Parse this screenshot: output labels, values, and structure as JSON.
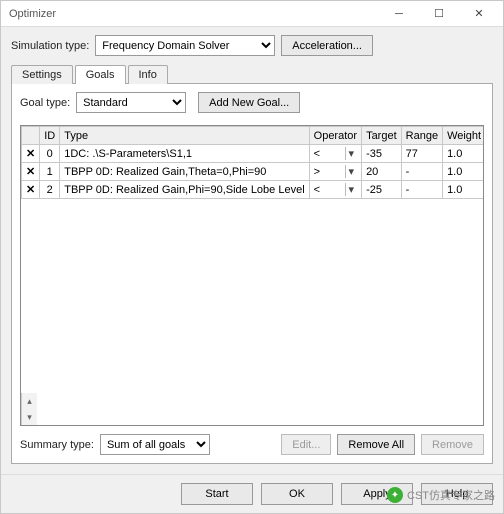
{
  "window": {
    "title": "Optimizer"
  },
  "simType": {
    "label": "Simulation type:",
    "value": "Frequency Domain Solver"
  },
  "accelBtn": "Acceleration...",
  "tabs": {
    "settings": "Settings",
    "goals": "Goals",
    "info": "Info",
    "active": "goals"
  },
  "goalType": {
    "label": "Goal type:",
    "value": "Standard"
  },
  "addGoalBtn": "Add New Goal...",
  "columns": {
    "id": "ID",
    "type": "Type",
    "operator": "Operator",
    "target": "Target",
    "range": "Range",
    "weight": "Weight"
  },
  "rows": [
    {
      "checked": true,
      "id": "0",
      "type": "1DC: .\\S-Parameters\\S1,1",
      "op": "<",
      "target": "-35",
      "range": "77",
      "weight": "1.0"
    },
    {
      "checked": true,
      "id": "1",
      "type": "TBPP 0D: Realized Gain,Theta=0,Phi=90",
      "op": ">",
      "target": "20",
      "range": "-",
      "weight": "1.0"
    },
    {
      "checked": true,
      "id": "2",
      "type": "TBPP 0D: Realized Gain,Phi=90,Side Lobe Level",
      "op": "<",
      "target": "-25",
      "range": "-",
      "weight": "1.0"
    }
  ],
  "summary": {
    "label": "Summary type:",
    "value": "Sum of all goals"
  },
  "panelBtns": {
    "edit": "Edit...",
    "removeAll": "Remove All",
    "remove": "Remove"
  },
  "footer": {
    "start": "Start",
    "ok": "OK",
    "apply": "Apply",
    "help": "Help"
  },
  "watermark": "CST仿真专家之路"
}
